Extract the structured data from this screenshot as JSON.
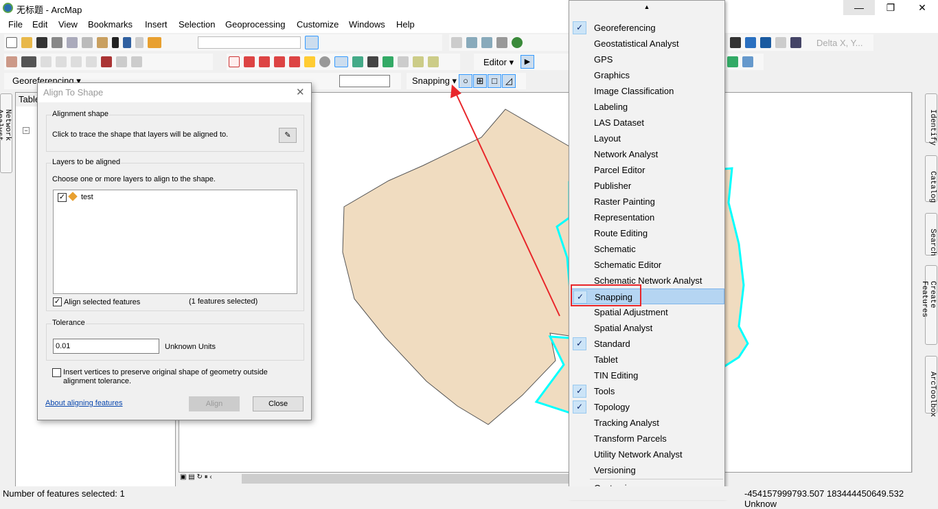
{
  "window": {
    "title": "无标题 - ArcMap",
    "minimize": "—",
    "restore": "❐",
    "close": "✕"
  },
  "menubar": [
    "File",
    "Edit",
    "View",
    "Bookmarks",
    "Insert",
    "Selection",
    "Geoprocessing",
    "Customize",
    "Windows",
    "Help"
  ],
  "toolbars": {
    "georeferencing_label": "Georeferencing ▾",
    "snapping_label": "Snapping ▾",
    "editor_label": "Editor ▾",
    "delta_label": "Delta X, Y..."
  },
  "left_tabs": {
    "network": "Network Analyst",
    "toc_title": "Table"
  },
  "right_tabs": [
    "Identify",
    "Catalog",
    "Search",
    "Create Features",
    "ArcToolbox"
  ],
  "dialog": {
    "title": "Align To Shape",
    "alignment_group": "Alignment shape",
    "alignment_text": "Click to trace the shape that layers will be aligned to.",
    "layers_group": "Layers to be aligned",
    "layers_text": "Choose one or more layers to align to the shape.",
    "layers": [
      {
        "name": "test",
        "checked": true
      }
    ],
    "align_selected_label": "Align selected features",
    "align_selected_checked": true,
    "selected_count": "(1 features selected)",
    "tolerance_group": "Tolerance",
    "tolerance_value": "0.01",
    "tolerance_units": "Unknown Units",
    "insert_vertices_label": "Insert vertices to preserve original shape of geometry outside alignment tolerance.",
    "insert_vertices_checked": false,
    "about_link": "About aligning features",
    "align_button": "Align",
    "close_button": "Close"
  },
  "toolbar_menu": {
    "scroll_up": "▲",
    "items": [
      {
        "label": "Georeferencing",
        "checked": true
      },
      {
        "label": "Geostatistical Analyst"
      },
      {
        "label": "GPS"
      },
      {
        "label": "Graphics"
      },
      {
        "label": "Image Classification"
      },
      {
        "label": "Labeling"
      },
      {
        "label": "LAS Dataset"
      },
      {
        "label": "Layout"
      },
      {
        "label": "Network Analyst"
      },
      {
        "label": "Parcel Editor"
      },
      {
        "label": "Publisher"
      },
      {
        "label": "Raster Painting"
      },
      {
        "label": "Representation"
      },
      {
        "label": "Route Editing"
      },
      {
        "label": "Schematic"
      },
      {
        "label": "Schematic Editor"
      },
      {
        "label": "Schematic Network Analyst"
      },
      {
        "label": "Snapping",
        "checked": true,
        "highlighted": true
      },
      {
        "label": "Spatial Adjustment"
      },
      {
        "label": "Spatial Analyst"
      },
      {
        "label": "Standard",
        "checked": true
      },
      {
        "label": "Tablet"
      },
      {
        "label": "TIN Editing"
      },
      {
        "label": "Tools",
        "checked": true
      },
      {
        "label": "Topology",
        "checked": true
      },
      {
        "label": "Tracking Analyst"
      },
      {
        "label": "Transform Parcels"
      },
      {
        "label": "Utility Network Analyst"
      },
      {
        "label": "Versioning"
      }
    ],
    "customize": "Customize..."
  },
  "status": {
    "selected": "Number of features selected: 1",
    "coords": "-454157999793.507  183444450649.532 Unknow"
  },
  "colors": {
    "polygon_fill": "#f0dcc0",
    "selection_outline": "#00ffff",
    "annotation": "#e8262a",
    "highlight": "#b5d5f2"
  }
}
